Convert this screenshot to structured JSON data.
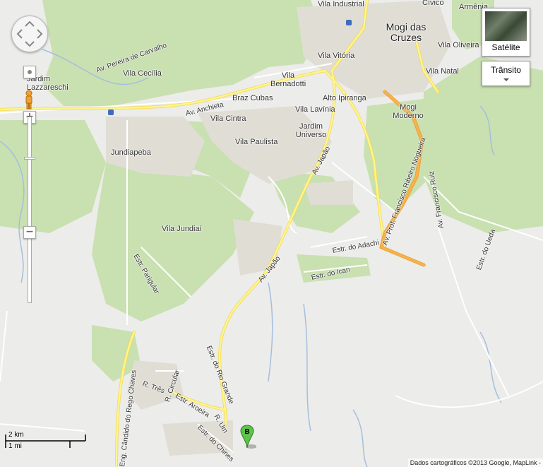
{
  "map": {
    "colors": {
      "land": "#ececea",
      "park": "#c9e0b1",
      "water": "#a5bfdd",
      "road": "#ffffff",
      "arterial": "#fef58f",
      "highway": "#f7b24c",
      "urban": "#e0ddd5"
    },
    "labels": {
      "vila_industrial": "Vila Industrial",
      "civico": "Cívico",
      "armenia": "Armênia",
      "mogi_das_cruzes": "Mogi das Cruzes",
      "vila_oliveira": "Vila Oliveira",
      "vila_vitoria": "Vila Vitória",
      "vila_bernadotti": "Vila Bernadotti",
      "vila_natal": "Vila Natal",
      "av_pereira_carvalho": "Av. Pereira de Carvalho",
      "vila_cecilia": "Vila Cecília",
      "jardim_lazzareschi": "Jardim Lazzareschi",
      "braz_cubas": "Braz Cubas",
      "alto_ipiranga": "Alto Ipiranga",
      "av_anchieta": "Av. Anchieta",
      "vila_lavinia": "Vila Lavínia",
      "mogi_moderno": "Mogi Moderno",
      "vila_cintra": "Vila Cintra",
      "jardim_universo": "Jardim Universo",
      "vila_paulista": "Vila Paulista",
      "jundiapeba": "Jundiapeba",
      "av_japao_north": "Av. Japão",
      "av_francisco_nogueira": "Av. Prof. Francisco Ribeiro Nogueira",
      "av_francisco_ruiz": "Av. Francisco Ruiz",
      "vila_jundiai": "Vila Jundiaí",
      "estr_adachi": "Estr. do Adachi",
      "estr_pargular": "Estr. Parigular",
      "av_japao_south": "Av. Japão",
      "estr_ican": "Estr. do Ican",
      "estr_ueda": "Estr. do Ueda",
      "estr_rio_grande": "Estr. do Rio Grande",
      "eng_candido": "Eng. Cândido do Rego Chaves",
      "r_tres": "R. Três",
      "r_circular": "R. Circular",
      "estr_aroeira": "Estr. Aroeira",
      "estr_chines": "Estr. do Chines",
      "r_um": "R. Um"
    },
    "marker": {
      "letter": "B"
    }
  },
  "controls": {
    "satellite_label": "Satélite",
    "traffic_label": "Trânsito",
    "zoom_in": "+",
    "zoom_out": "−",
    "scale_km": "2 km",
    "scale_mi": "1 mi"
  },
  "credit": "Dados cartográficos ©2013 Google, MapLink -"
}
